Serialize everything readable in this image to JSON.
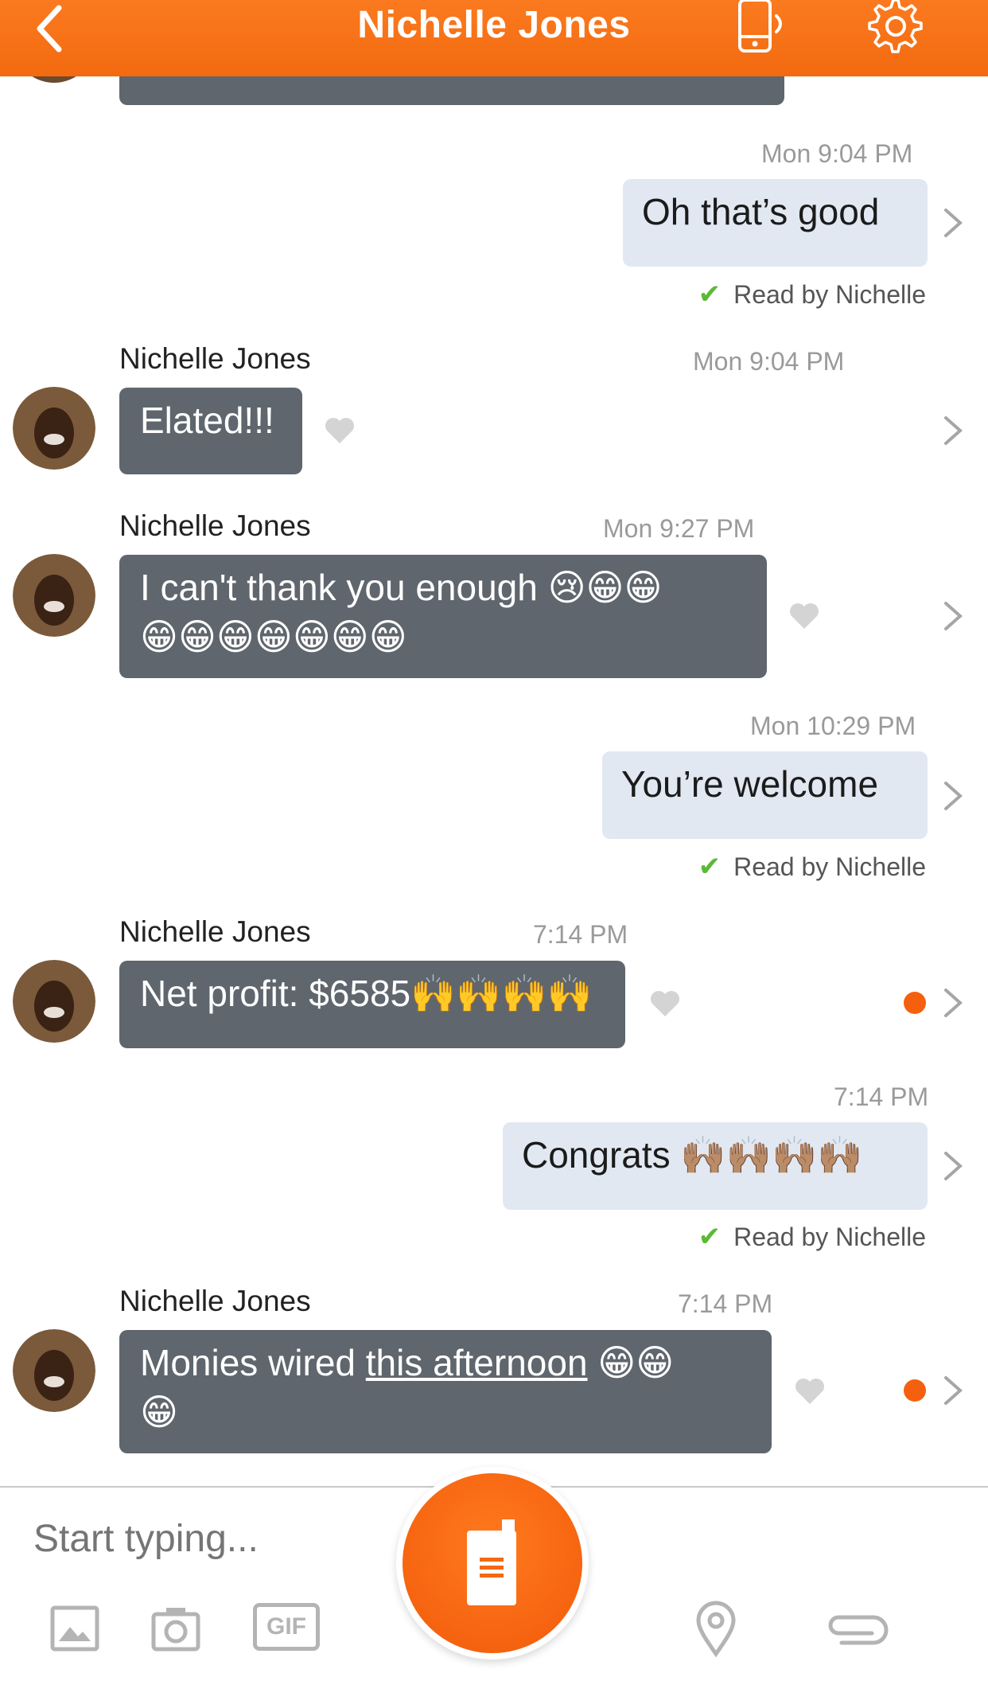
{
  "header": {
    "title": "Nichelle Jones",
    "back_icon": "chevron-left-icon",
    "walkie_icon": "walkie-talkie-icon",
    "settings_icon": "gear-icon",
    "color": "#f36a10"
  },
  "messages": [
    {
      "direction": "out",
      "time": "Mon 9:04 PM",
      "text": "Oh that’s good",
      "read": "Read by Nichelle"
    },
    {
      "direction": "in",
      "sender": "Nichelle Jones",
      "time": "Mon 9:04 PM",
      "text": "Elated!!!"
    },
    {
      "direction": "in",
      "sender": "Nichelle Jones",
      "time": "Mon 9:27 PM",
      "text_line1": "I can't thank you enough 😢😁😁",
      "text_line2": "😁😁😁😁😁😁😁"
    },
    {
      "direction": "out",
      "time": "Mon 10:29 PM",
      "text": "You’re welcome",
      "read": "Read by Nichelle"
    },
    {
      "direction": "in",
      "sender": "Nichelle Jones",
      "time": "7:14 PM",
      "text": "Net profit: $6585🙌🙌🙌🙌"
    },
    {
      "direction": "out",
      "time": "7:14 PM",
      "text": "Congrats 🙌🏽🙌🏽🙌🏽🙌🏽",
      "read": "Read by Nichelle"
    },
    {
      "direction": "in",
      "sender": "Nichelle Jones",
      "time": "7:14 PM",
      "text_pre": "Monies wired ",
      "text_link": "this afternoon",
      "text_post": " 😁😁",
      "text_line2": "😁"
    }
  ],
  "composer": {
    "placeholder": "Start typing...",
    "tools": [
      "image-icon",
      "camera-icon",
      "gif-icon",
      "push-to-talk-icon",
      "location-pin-icon",
      "paperclip-icon"
    ],
    "gif_label": "GIF"
  }
}
